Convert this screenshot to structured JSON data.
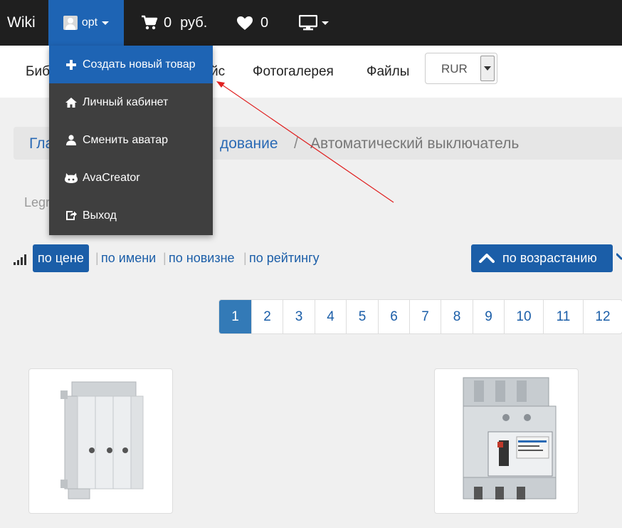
{
  "topbar": {
    "brand": "Wiki",
    "user": "opt",
    "cart_count": "0",
    "cart_currency": "руб.",
    "favorites_count": "0"
  },
  "user_dropdown": {
    "items": [
      {
        "label": "Создать новый товар",
        "icon": "plus-icon"
      },
      {
        "label": "Личный кабинет",
        "icon": "home-icon"
      },
      {
        "label": "Сменить аватар",
        "icon": "user-icon"
      },
      {
        "label": "AvaCreator",
        "icon": "github-icon"
      },
      {
        "label": "Выход",
        "icon": "exit-icon"
      }
    ]
  },
  "subnav": {
    "link_1": "Биб",
    "link_1_tail": "йс",
    "gallery": "Фотогалерея",
    "files": "Файлы",
    "currency": "RUR"
  },
  "breadcrumb": {
    "home": "Гла",
    "category": "дование",
    "separator": "/",
    "current": "Автоматический выключатель"
  },
  "brand_filter": "Legr",
  "sorting": {
    "active": "по цене",
    "by_name": "по имени",
    "by_newness": "по новизне",
    "by_rating": "по рейтингу",
    "separator": "|",
    "order": "по возрастанию"
  },
  "pagination": {
    "pages": [
      "1",
      "2",
      "3",
      "4",
      "5",
      "6",
      "7",
      "8",
      "9",
      "10",
      "11",
      "12"
    ],
    "active": "1"
  },
  "products": [
    {
      "image": "breaker-side-module"
    },
    {
      "image": "circuit-breaker-dpx"
    }
  ],
  "colors": {
    "topbar": "#1f1f1f",
    "accent": "#1e64b4",
    "dropdown": "#3f3f3f",
    "link": "#1b5ea8",
    "annotation_arrow": "#e02020"
  }
}
